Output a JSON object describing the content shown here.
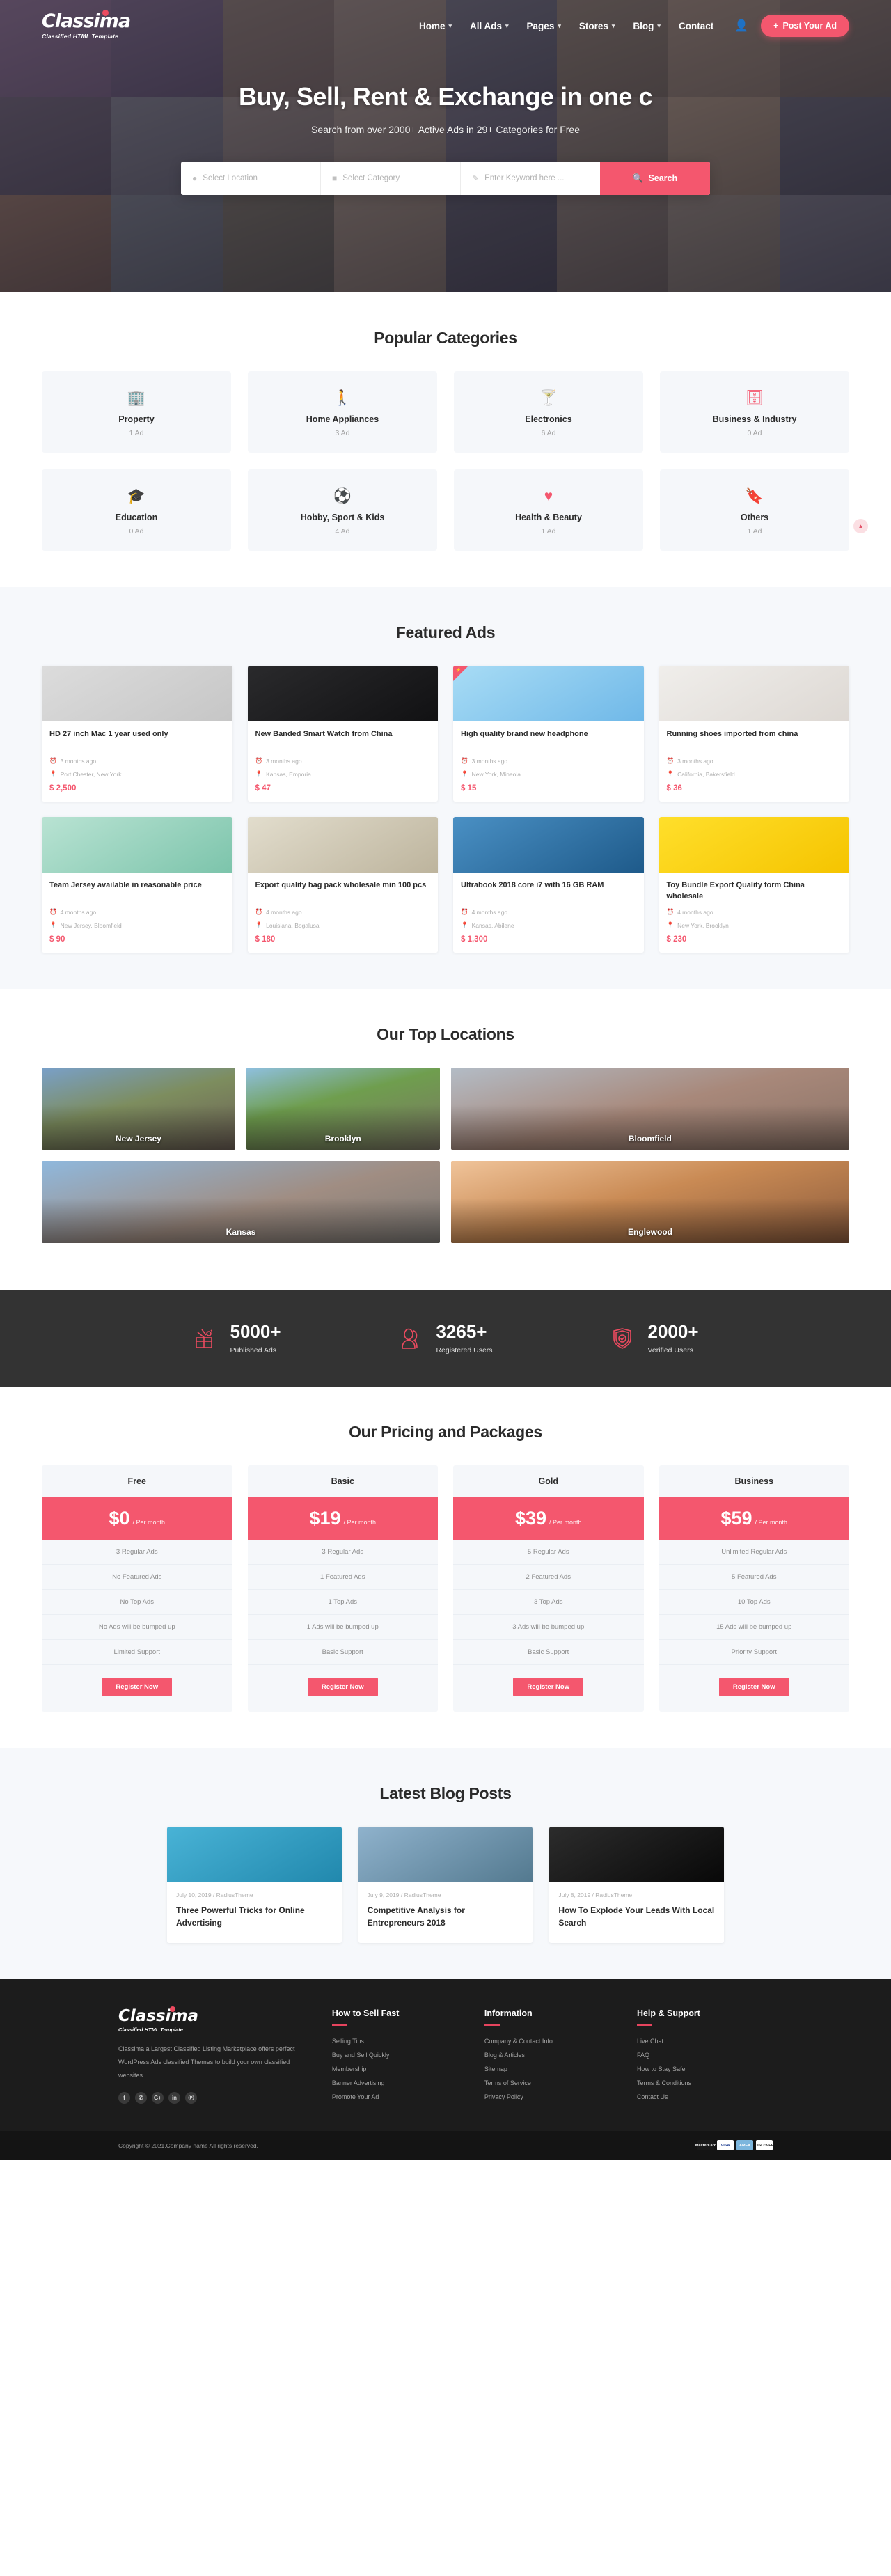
{
  "brand": {
    "name": "Classima",
    "tagline": "Classified HTML Template"
  },
  "nav": {
    "items": [
      {
        "label": "Home",
        "has_dropdown": true
      },
      {
        "label": "All Ads",
        "has_dropdown": true
      },
      {
        "label": "Pages",
        "has_dropdown": true
      },
      {
        "label": "Stores",
        "has_dropdown": true
      },
      {
        "label": "Blog",
        "has_dropdown": true
      },
      {
        "label": "Contact",
        "has_dropdown": false
      }
    ],
    "account_icon": "user-icon",
    "post_ad_label": "Post Your Ad"
  },
  "hero": {
    "title": "Buy, Sell, Rent & Exchange in one c",
    "subtitle": "Search from over 2000+ Active Ads in 29+ Categories for Free",
    "search": {
      "location_placeholder": "Select Location",
      "category_placeholder": "Select Category",
      "keyword_placeholder": "Enter Keyword here ...",
      "button_label": "Search"
    }
  },
  "categories": {
    "title": "Popular Categories",
    "items": [
      {
        "name": "Property",
        "count": "1 Ad",
        "icon": "building-icon",
        "glyph": "🏢"
      },
      {
        "name": "Home Appliances",
        "count": "3 Ad",
        "icon": "appliance-icon",
        "glyph": "🚶"
      },
      {
        "name": "Electronics",
        "count": "6 Ad",
        "icon": "electronics-icon",
        "glyph": "🍸"
      },
      {
        "name": "Business & Industry",
        "count": "0 Ad",
        "icon": "briefcase-icon",
        "glyph": "🗄"
      },
      {
        "name": "Education",
        "count": "0 Ad",
        "icon": "graduation-cap-icon",
        "glyph": "🎓"
      },
      {
        "name": "Hobby, Sport & Kids",
        "count": "4 Ad",
        "icon": "ball-icon",
        "glyph": "⚽"
      },
      {
        "name": "Health & Beauty",
        "count": "1 Ad",
        "icon": "heart-icon",
        "glyph": "♥"
      },
      {
        "name": "Others",
        "count": "1 Ad",
        "icon": "tag-icon",
        "glyph": "🔖"
      }
    ]
  },
  "featured": {
    "title": "Featured Ads",
    "ads": [
      {
        "title": "HD 27 inch Mac 1 year used only",
        "time": "3 months ago",
        "location": "Port Chester, New York",
        "price": "$ 2,500",
        "thumb": "#d3d3d3",
        "featured_badge": false
      },
      {
        "title": "New Banded Smart Watch from China",
        "time": "3 months ago",
        "location": "Kansas, Emporia",
        "price": "$ 47",
        "thumb": "#1c1c1e",
        "featured_badge": false
      },
      {
        "title": "High quality brand new headphone",
        "time": "3 months ago",
        "location": "New York, Mineola",
        "price": "$ 15",
        "thumb": "#8ecbf2",
        "featured_badge": true
      },
      {
        "title": "Running shoes imported from china",
        "time": "3 months ago",
        "location": "California, Bakersfield",
        "price": "$ 36",
        "thumb": "#e9e6e3",
        "featured_badge": false
      },
      {
        "title": "Team Jersey available in reasonable price",
        "time": "4 months ago",
        "location": "New Jersey, Bloomfield",
        "price": "$ 90",
        "thumb": "#9fd8c4",
        "featured_badge": false
      },
      {
        "title": "Export quality bag pack wholesale min 100 pcs",
        "time": "4 months ago",
        "location": "Louisiana, Bogalusa",
        "price": "$ 180",
        "thumb": "#d8d2c2",
        "featured_badge": false
      },
      {
        "title": "Ultrabook 2018 core i7 with 16 GB RAM",
        "time": "4 months ago",
        "location": "Kansas, Abilene",
        "price": "$ 1,300",
        "thumb": "#2f6fa8",
        "featured_badge": false
      },
      {
        "title": "Toy Bundle Export Quality form China wholesale",
        "time": "4 months ago",
        "location": "New York, Brooklyn",
        "price": "$ 230",
        "thumb": "#ffd300",
        "featured_badge": false
      }
    ]
  },
  "locations": {
    "title": "Our Top Locations",
    "row1": [
      {
        "name": "New Jersey",
        "tint": "#6f8a52"
      },
      {
        "name": "Brooklyn",
        "tint": "#5d8a46"
      },
      {
        "name": "Bloomfield",
        "tint": "#9a8070"
      }
    ],
    "row2": [
      {
        "name": "Kansas",
        "tint": "#8a8a96"
      },
      {
        "name": "Englewood",
        "tint": "#b67b4a"
      }
    ]
  },
  "counters": [
    {
      "value": "5000+",
      "label": "Published Ads",
      "icon": "gift-icon"
    },
    {
      "value": "3265+",
      "label": "Registered Users",
      "icon": "users-icon"
    },
    {
      "value": "2000+",
      "label": "Verified Users",
      "icon": "shield-check-icon"
    }
  ],
  "pricing": {
    "title": "Our Pricing and Packages",
    "per_label": "/ Per month",
    "button_label": "Register Now",
    "plans": [
      {
        "name": "Free",
        "price": "$0",
        "features": [
          "3 Regular Ads",
          "No Featured Ads",
          "No Top Ads",
          "No Ads will be bumped up",
          "Limited Support"
        ]
      },
      {
        "name": "Basic",
        "price": "$19",
        "features": [
          "3 Regular Ads",
          "1 Featured Ads",
          "1 Top Ads",
          "1 Ads will be bumped up",
          "Basic Support"
        ]
      },
      {
        "name": "Gold",
        "price": "$39",
        "features": [
          "5 Regular Ads",
          "2 Featured Ads",
          "3 Top Ads",
          "3 Ads will be bumped up",
          "Basic Support"
        ]
      },
      {
        "name": "Business",
        "price": "$59",
        "features": [
          "Unlimited Regular Ads",
          "5 Featured Ads",
          "10 Top Ads",
          "15 Ads will be bumped up",
          "Priority Support"
        ]
      }
    ]
  },
  "blog": {
    "title": "Latest Blog Posts",
    "posts": [
      {
        "meta": "July 10, 2019 / RadiusTheme",
        "title": "Three Powerful Tricks for Online Advertising",
        "thumb": "#2e9fc4"
      },
      {
        "meta": "July 9, 2019 / RadiusTheme",
        "title": "Competitive Analysis for Entrepreneurs 2018",
        "thumb": "#6f9fc0"
      },
      {
        "meta": "July 8, 2019 / RadiusTheme",
        "title": "How To Explode Your Leads With Local Search",
        "thumb": "#1a1a1a"
      }
    ]
  },
  "footer": {
    "description": "Classima a Largest Classified Listing Marketplace offers perfect WordPress Ads classified Themes to build your own classified websites.",
    "social": [
      {
        "name": "facebook-icon",
        "glyph": "f"
      },
      {
        "name": "twitter-icon",
        "glyph": "✆"
      },
      {
        "name": "google-plus-icon",
        "glyph": "G+"
      },
      {
        "name": "linkedin-icon",
        "glyph": "in"
      },
      {
        "name": "pinterest-icon",
        "glyph": "Ⓟ"
      }
    ],
    "columns": [
      {
        "heading": "How to Sell Fast",
        "links": [
          "Selling Tips",
          "Buy and Sell Quickly",
          "Membership",
          "Banner Advertising",
          "Promote Your Ad"
        ]
      },
      {
        "heading": "Information",
        "links": [
          "Company & Contact Info",
          "Blog & Articles",
          "Sitemap",
          "Terms of Service",
          "Privacy Policy"
        ]
      },
      {
        "heading": "Help & Support",
        "links": [
          "Live Chat",
          "FAQ",
          "How to Stay Safe",
          "Terms & Conditions",
          "Contact Us"
        ]
      }
    ],
    "copyright": "Copyright © 2021.Company name All rights reserved.",
    "payment_cards": [
      {
        "name": "mastercard-icon",
        "label": "MasterCard",
        "bg": "#1a1a1a",
        "fg": "#ffffff"
      },
      {
        "name": "visa-icon",
        "label": "VISA",
        "bg": "#ffffff",
        "fg": "#1a3a8f"
      },
      {
        "name": "amex-icon",
        "label": "AMEX",
        "bg": "#7cb6dd",
        "fg": "#ffffff"
      },
      {
        "name": "discover-icon",
        "label": "DISC○VER",
        "bg": "#ffffff",
        "fg": "#1a1a1a"
      }
    ]
  },
  "scroll_top": {
    "icon": "chevron-up-icon",
    "glyph": "▲"
  },
  "accent_color": "#f4576e"
}
